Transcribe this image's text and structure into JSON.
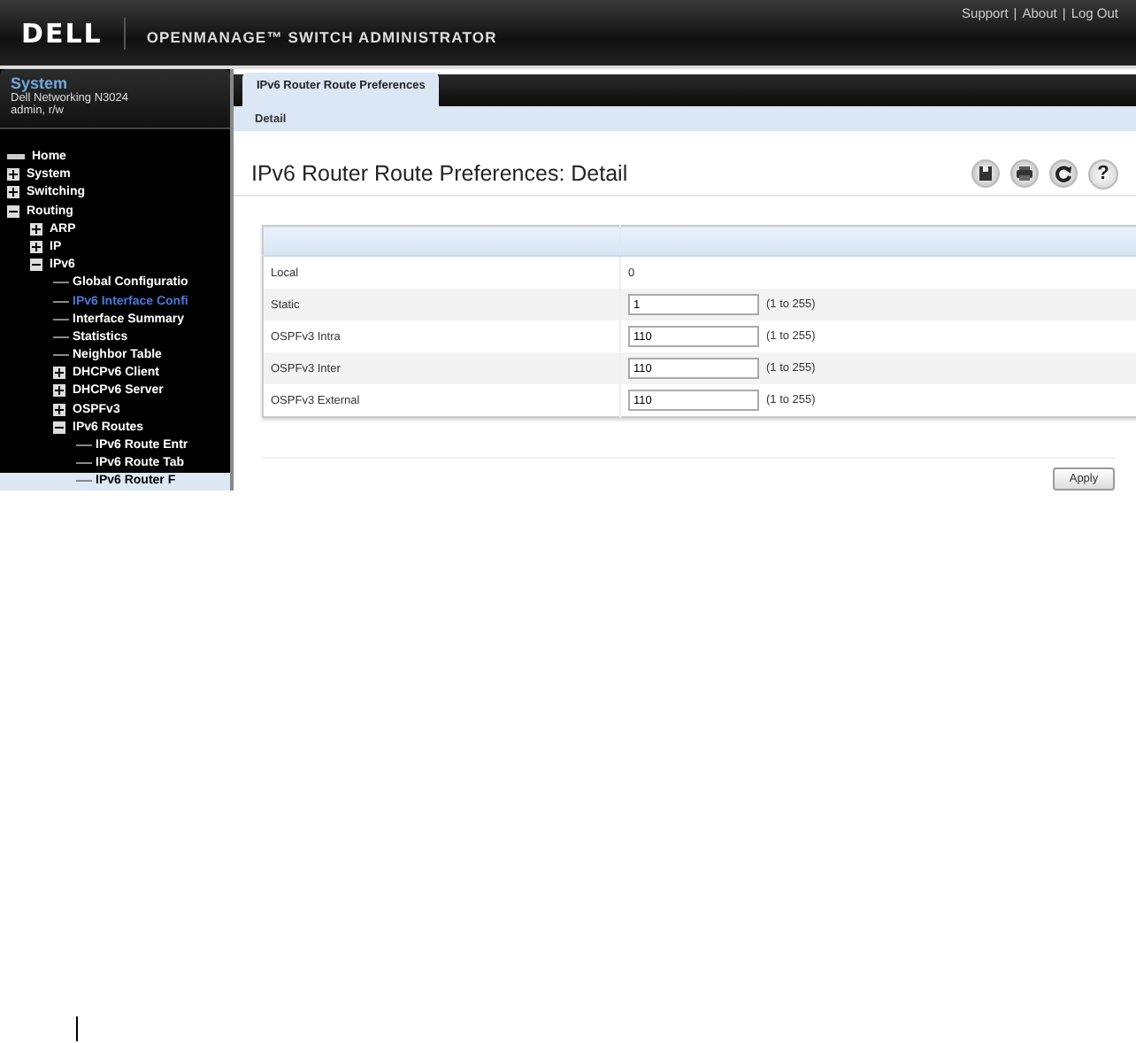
{
  "header": {
    "logo": "DELL",
    "title": "OPENMANAGE™ SWITCH ADMINISTRATOR",
    "links": [
      "Support",
      "About",
      "Log Out"
    ],
    "separator": "|"
  },
  "sidebar": {
    "title": "System",
    "device": "Dell Networking N3024",
    "user": "admin, r/w",
    "items": [
      {
        "label": "Home",
        "kind": "home",
        "selected": false,
        "visited": false
      },
      {
        "label": "System",
        "kind": "node",
        "expanded": false,
        "selected": false,
        "visited": false
      },
      {
        "label": "Switching",
        "kind": "node",
        "expanded": false,
        "selected": false,
        "visited": false
      },
      {
        "label": "Routing",
        "kind": "node",
        "expanded": true,
        "selected": false,
        "visited": false,
        "children": [
          {
            "label": "ARP",
            "kind": "node",
            "expanded": false,
            "selected": false,
            "visited": false
          },
          {
            "label": "IP",
            "kind": "node",
            "expanded": false,
            "selected": false,
            "visited": false
          },
          {
            "label": "IPv6",
            "kind": "node",
            "expanded": true,
            "selected": false,
            "visited": false,
            "children": [
              {
                "label": "Global Configuratio",
                "kind": "leaf",
                "selected": false,
                "visited": false
              },
              {
                "label": "IPv6 Interface Confi",
                "kind": "leaf",
                "selected": false,
                "visited": true
              },
              {
                "label": "Interface Summary",
                "kind": "leaf",
                "selected": false,
                "visited": false
              },
              {
                "label": "Statistics",
                "kind": "leaf",
                "selected": false,
                "visited": false
              },
              {
                "label": "Neighbor Table",
                "kind": "leaf",
                "selected": false,
                "visited": false
              },
              {
                "label": "DHCPv6 Client",
                "kind": "node",
                "expanded": false,
                "selected": false,
                "visited": false
              },
              {
                "label": "DHCPv6 Server",
                "kind": "node",
                "expanded": false,
                "selected": false,
                "visited": false
              },
              {
                "label": "OSPFv3",
                "kind": "node",
                "expanded": false,
                "selected": false,
                "visited": false
              },
              {
                "label": "IPv6 Routes",
                "kind": "node",
                "expanded": true,
                "selected": false,
                "visited": false,
                "children": [
                  {
                    "label": "IPv6 Route Entr",
                    "kind": "leaf",
                    "selected": false,
                    "visited": false
                  },
                  {
                    "label": "IPv6 Route Tab",
                    "kind": "leaf",
                    "selected": false,
                    "visited": false
                  },
                  {
                    "label": "IPv6 Router F",
                    "kind": "leaf",
                    "selected": true,
                    "visited": false
                  }
                ]
              }
            ]
          }
        ]
      }
    ]
  },
  "tabs": [
    {
      "label": "IPv6 Router Route Preferences",
      "selected": true
    }
  ],
  "subtabs": [
    {
      "label": "Detail",
      "selected": true
    }
  ],
  "page_title": "IPv6 Router Route Preferences: Detail",
  "toolbar": {
    "help": "?"
  },
  "rows": [
    {
      "label": "Local",
      "kind": "static",
      "value": "0"
    },
    {
      "label": "Static",
      "kind": "input",
      "value": "1",
      "range": "(1 to 255)"
    },
    {
      "label": "OSPFv3 Intra",
      "kind": "input",
      "value": "110",
      "range": "(1 to 255)"
    },
    {
      "label": "OSPFv3 Inter",
      "kind": "input",
      "value": "110",
      "range": "(1 to 255)"
    },
    {
      "label": "OSPFv3 External",
      "kind": "input",
      "value": "110",
      "range": "(1 to 255)"
    }
  ],
  "apply_button": "Apply"
}
